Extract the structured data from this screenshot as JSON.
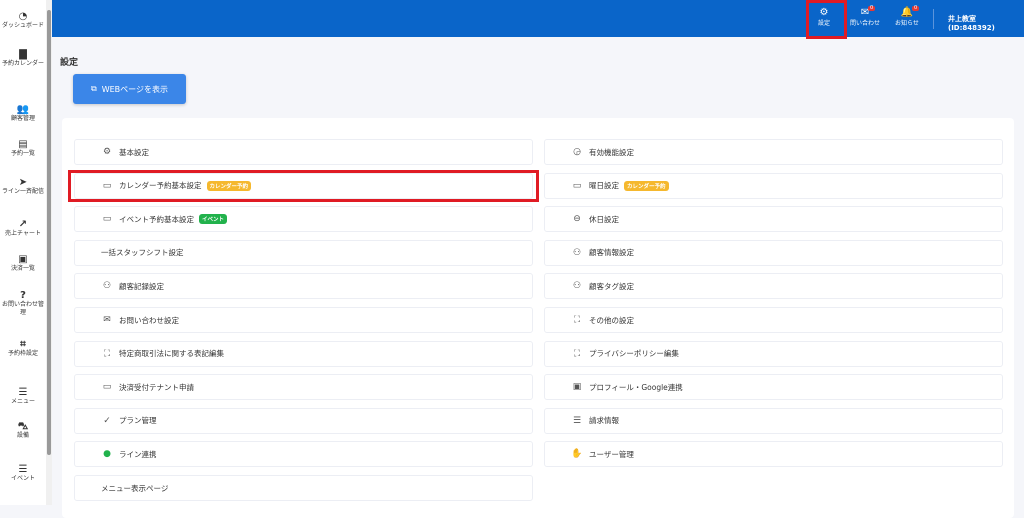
{
  "sidebar": {
    "items": [
      {
        "icon": "dashboard-icon",
        "glyph": "◔",
        "label": "ダッシュボード"
      },
      {
        "icon": "calendar-icon",
        "glyph": "▇",
        "label": "予約カレンダー"
      },
      {
        "icon": "users-icon",
        "glyph": "👥",
        "label": "顧客管理"
      },
      {
        "icon": "clipboard-icon",
        "glyph": "▤",
        "label": "予約一覧"
      },
      {
        "icon": "send-icon",
        "glyph": "➤",
        "label": "ライン一斉配信"
      },
      {
        "icon": "chart-icon",
        "glyph": "↗",
        "label": "売上チャート"
      },
      {
        "icon": "money-icon",
        "glyph": "▣",
        "label": "決済一覧"
      },
      {
        "icon": "question-icon",
        "glyph": "?",
        "label": "お問い合わせ管理"
      },
      {
        "icon": "crop-icon",
        "glyph": "⌗",
        "label": "予約枠設定"
      },
      {
        "icon": "list-icon",
        "glyph": "☰",
        "label": "メニュー"
      },
      {
        "icon": "car-icon",
        "glyph": "⛍",
        "label": "設備"
      },
      {
        "icon": "list-icon",
        "glyph": "☰",
        "label": "イベント"
      }
    ]
  },
  "header": {
    "settings": "設定",
    "inquiry": "問い合わせ",
    "inquiry_count": "0",
    "notice": "お知らせ",
    "notice_count": "0",
    "user": "井上教室 (ID:848392)"
  },
  "page": {
    "title": "設定",
    "web_button": "WEBページを表示"
  },
  "badges": {
    "calendar": "カレンダー予約",
    "event": "イベント"
  },
  "colors": {
    "header": "#0a65c9",
    "calendar_badge": "#f5b82e",
    "event_badge": "#22b24c",
    "highlight": "#e01b24"
  },
  "left": [
    {
      "label": "基本設定",
      "glyph": "⚙",
      "icon": "gear-icon"
    },
    {
      "label": "カレンダー予約基本設定",
      "glyph": "▭",
      "icon": "calendar-icon",
      "badge": "calendar"
    },
    {
      "label": "イベント予約基本設定",
      "glyph": "▭",
      "icon": "calendar-icon",
      "badge": "event"
    },
    {
      "label": "一括スタッフシフト設定",
      "glyph": "",
      "icon": ""
    },
    {
      "label": "顧客記録設定",
      "glyph": "⚇",
      "icon": "user-plus-icon"
    },
    {
      "label": "お問い合わせ設定",
      "glyph": "✉",
      "icon": "mail-icon"
    },
    {
      "label": "特定商取引法に関する表記編集",
      "glyph": "⛶",
      "icon": "dashed-box-icon"
    },
    {
      "label": "決済受付テナント申請",
      "glyph": "▭",
      "icon": "credit-card-icon"
    },
    {
      "label": "プラン管理",
      "glyph": "✓",
      "icon": "check-circle-icon"
    },
    {
      "label": "ライン連携",
      "glyph": "●",
      "icon": "line-icon"
    },
    {
      "label": "メニュー表示ページ",
      "glyph": "",
      "icon": ""
    }
  ],
  "right": [
    {
      "label": "有効機能設定",
      "glyph": "◶",
      "icon": "features-icon"
    },
    {
      "label": "曜日設定",
      "glyph": "▭",
      "icon": "calendar-icon",
      "badge": "calendar"
    },
    {
      "label": "休日設定",
      "glyph": "⊖",
      "icon": "minus-circle-icon"
    },
    {
      "label": "顧客情報設定",
      "glyph": "⚇",
      "icon": "users-icon"
    },
    {
      "label": "顧客タグ設定",
      "glyph": "⚇",
      "icon": "user-plus-icon"
    },
    {
      "label": "その他の設定",
      "glyph": "⛶",
      "icon": "dashed-box-icon"
    },
    {
      "label": "プライバシーポリシー編集",
      "glyph": "⛶",
      "icon": "dashed-box-icon"
    },
    {
      "label": "プロフィール・Google連携",
      "glyph": "▣",
      "icon": "id-card-icon"
    },
    {
      "label": "請求情報",
      "glyph": "☰",
      "icon": "billing-icon"
    },
    {
      "label": "ユーザー管理",
      "glyph": "✋",
      "icon": "hand-icon"
    }
  ]
}
